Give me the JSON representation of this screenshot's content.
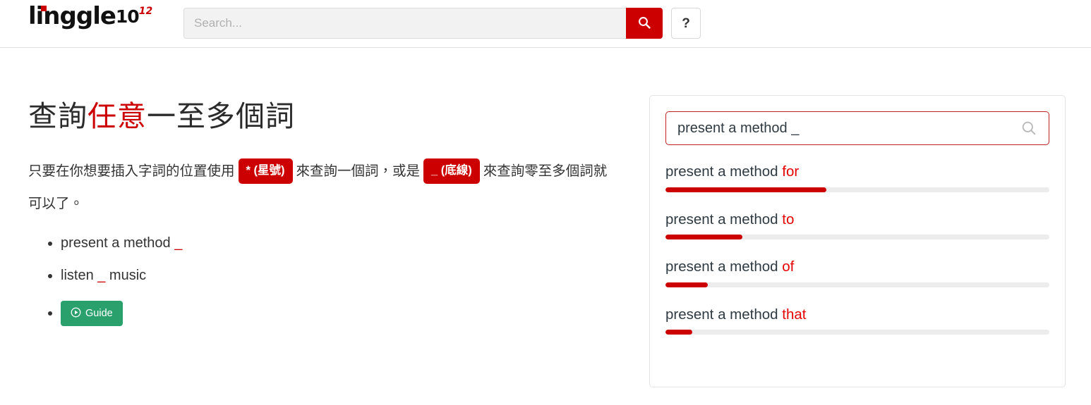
{
  "brand": {
    "name_lead": "l",
    "name_rest": "inggle",
    "version": "10",
    "superscript": "12"
  },
  "header": {
    "search_placeholder": "Search...",
    "search_value": "",
    "search_icon": "search-icon",
    "help_label": "?"
  },
  "main": {
    "title_part1": "查詢",
    "title_highlight": "任意",
    "title_part2": "一至多個詞",
    "desc_part1": "只要在你想要插入字詞的位置使用",
    "badge_star": "* (星號)",
    "desc_part2": "來查詢一個詞，或是",
    "badge_underscore": "_ (底線)",
    "desc_part3": "來查詢零至多個詞就可以了。",
    "examples": [
      {
        "prefix": "present a method ",
        "token": "_",
        "suffix": ""
      },
      {
        "prefix": "listen ",
        "token": "_",
        "suffix": " music"
      }
    ],
    "guide_button": {
      "label": "Guide",
      "icon": "play-circle-icon",
      "color": "#2aa06d"
    }
  },
  "demo": {
    "query_value": "present a method _",
    "query_icon": "search-icon",
    "results": [
      {
        "phrase": "present a method ",
        "hit": "for",
        "percent": 42
      },
      {
        "phrase": "present a method ",
        "hit": "to",
        "percent": 20
      },
      {
        "phrase": "present a method ",
        "hit": "of",
        "percent": 11
      },
      {
        "phrase": "present a method ",
        "hit": "that",
        "percent": 7
      }
    ]
  },
  "colors": {
    "brand_red": "#cc0000",
    "hit_red": "#e40000",
    "guide_green": "#2aa06d",
    "track_gray": "#ececec"
  }
}
